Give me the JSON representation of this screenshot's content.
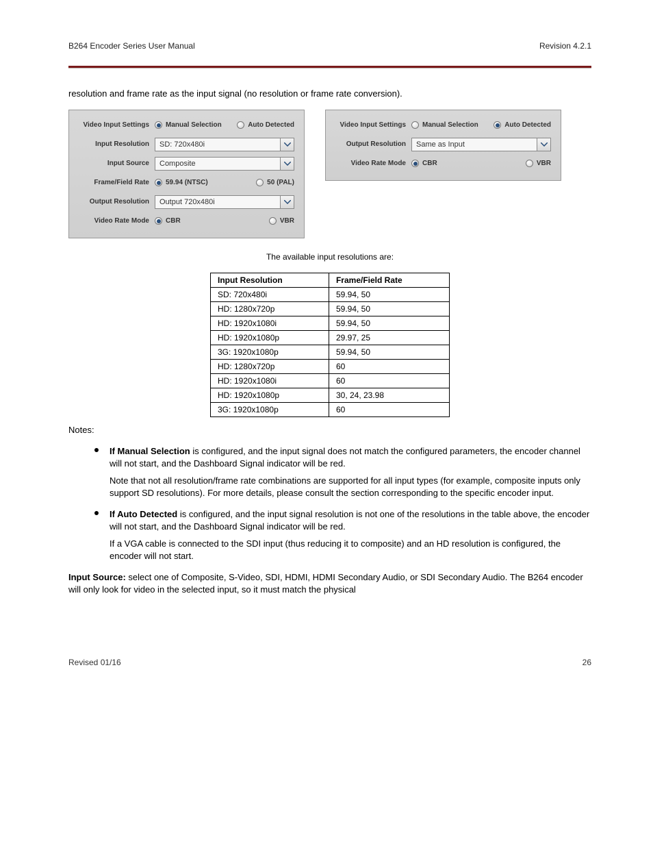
{
  "header": {
    "title": "B264 Encoder Series User Manual",
    "subtitle": "Revision 4.2.1"
  },
  "para_intro": "resolution and frame rate as the input signal (no resolution or frame rate conversion).",
  "panel_left": {
    "rows": {
      "video_input_label": "Video Input Settings",
      "video_input_opt1": "Manual Selection",
      "video_input_opt2": "Auto Detected",
      "input_resolution_label": "Input Resolution",
      "input_resolution_value": "SD: 720x480i",
      "input_source_label": "Input Source",
      "input_source_value": "Composite",
      "frame_rate_label": "Frame/Field Rate",
      "frame_rate_opt1": "59.94 (NTSC)",
      "frame_rate_opt2": "50 (PAL)",
      "output_resolution_label": "Output Resolution",
      "output_resolution_value": "Output 720x480i",
      "video_rate_mode_label": "Video Rate Mode",
      "video_rate_mode_opt1": "CBR",
      "video_rate_mode_opt2": "VBR"
    }
  },
  "panel_right": {
    "rows": {
      "video_input_label": "Video Input Settings",
      "video_input_opt1": "Manual Selection",
      "video_input_opt2": "Auto Detected",
      "output_resolution_label": "Output Resolution",
      "output_resolution_value": "Same as Input",
      "video_rate_mode_label": "Video Rate Mode",
      "video_rate_mode_opt1": "CBR",
      "video_rate_mode_opt2": "VBR"
    }
  },
  "caption": "The available input resolutions are:",
  "table": {
    "headers": [
      "Input Resolution",
      "Frame/Field Rate"
    ],
    "rows": [
      [
        "SD: 720x480i",
        "59.94, 50"
      ],
      [
        "HD: 1280x720p",
        "59.94, 50"
      ],
      [
        "HD: 1920x1080i",
        "59.94, 50"
      ],
      [
        "HD: 1920x1080p",
        "29.97, 25"
      ],
      [
        "3G: 1920x1080p",
        "59.94, 50"
      ],
      [
        "HD: 1280x720p",
        "60"
      ],
      [
        "HD: 1920x1080i",
        "60"
      ],
      [
        "HD: 1920x1080p",
        "30, 24, 23.98"
      ],
      [
        "3G: 1920x1080p",
        "60"
      ]
    ]
  },
  "notes_label": "Notes:",
  "bullets": [
    {
      "lead": "If Manual Selection",
      "rest": " is configured, and the input signal does not match the configured parameters, the encoder channel will not start, and the Dashboard Signal indicator will be red."
    },
    {
      "lead": "If Auto Detected",
      "rest": " is configured, and the input signal resolution is not one of the resolutions in the table above, the encoder will not start, and the Dashboard Signal indicator will be red."
    }
  ],
  "bullet_extra": {
    "b0_p2": "Note that not all resolution/frame rate combinations are supported for all input types (for example, composite inputs only support SD resolutions). For more details, please consult the section corresponding to the specific encoder input.",
    "b1_p2": "If a VGA cable is connected to the SDI input (thus reducing it to composite) and an HD resolution is configured, the encoder will not start."
  },
  "input_source_label": "Input Source:",
  "input_source_text": " select one of Composite, S-Video, SDI, HDMI, HDMI Secondary Audio, or SDI Secondary Audio. The B264 encoder will only look for video in the selected input, so it must match the physical",
  "footer": {
    "left": "Revised 01/16",
    "right": "26"
  }
}
